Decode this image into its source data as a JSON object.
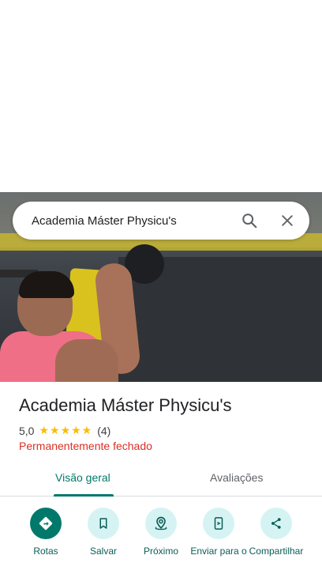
{
  "search": {
    "query": "Academia Máster Physicu's"
  },
  "place": {
    "name": "Academia Máster Physicu's",
    "rating": "5,0",
    "stars": "★★★★★",
    "review_count": "(4)",
    "status": "Permanentemente fechado"
  },
  "tabs": [
    {
      "label": "Visão geral",
      "selected": true
    },
    {
      "label": "Avaliações",
      "selected": false
    }
  ],
  "actions": [
    {
      "label": "Rotas",
      "icon": "directions-icon"
    },
    {
      "label": "Salvar",
      "icon": "bookmark-icon"
    },
    {
      "label": "Próximo",
      "icon": "nearby-icon"
    },
    {
      "label": "Enviar para o",
      "icon": "send-to-phone-icon"
    },
    {
      "label": "Compartilhar",
      "icon": "share-icon"
    }
  ],
  "colors": {
    "accent": "#00796b",
    "closed": "#d93025",
    "star": "#fbbc04",
    "action_bg": "#d6f3f3"
  }
}
